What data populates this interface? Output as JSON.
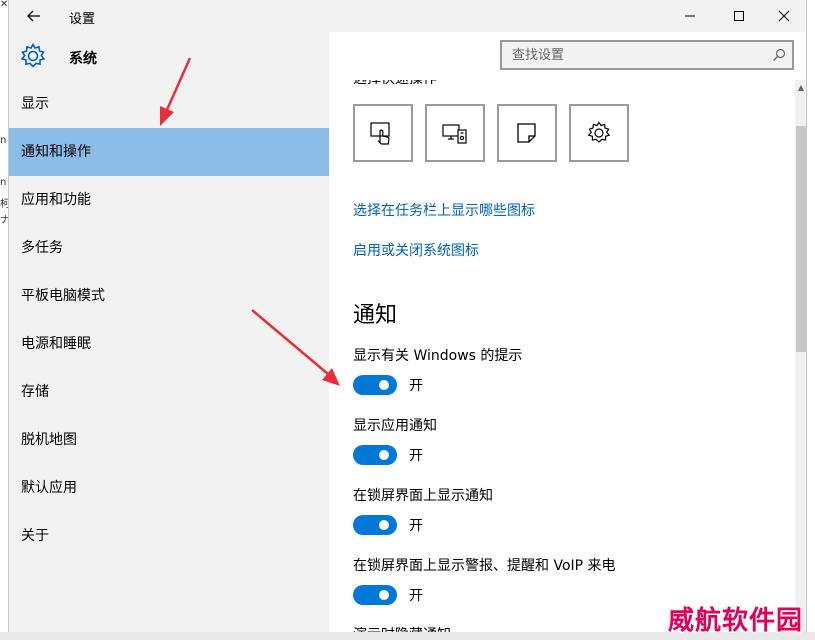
{
  "window": {
    "title": "设置"
  },
  "header": {
    "section_title": "系统"
  },
  "search": {
    "placeholder": "查找设置"
  },
  "sidebar": {
    "items": [
      {
        "label": "显示"
      },
      {
        "label": "通知和操作"
      },
      {
        "label": "应用和功能"
      },
      {
        "label": "多任务"
      },
      {
        "label": "平板电脑模式"
      },
      {
        "label": "电源和睡眠"
      },
      {
        "label": "存储"
      },
      {
        "label": "脱机地图"
      },
      {
        "label": "默认应用"
      },
      {
        "label": "关于"
      }
    ],
    "selected_index": 1
  },
  "main": {
    "partial_heading": "选择快速操作",
    "quick_action_icons": [
      "tablet-mode-icon",
      "connect-display-icon",
      "note-icon",
      "settings-gear-icon"
    ],
    "links": {
      "taskbar_icons": "选择在任务栏上显示哪些图标",
      "system_icons": "启用或关闭系统图标"
    },
    "notifications": {
      "heading": "通知",
      "settings": [
        {
          "label": "显示有关 Windows 的提示",
          "state": "开"
        },
        {
          "label": "显示应用通知",
          "state": "开"
        },
        {
          "label": "在锁屏界面上显示通知",
          "state": "开"
        },
        {
          "label": "在锁屏界面上显示警报、提醒和 VoIP 来电",
          "state": "开"
        }
      ],
      "cut_off_label": "演示时隐藏通知"
    }
  },
  "colors": {
    "selected_nav": "#8bbde8",
    "toggle_on": "#0078d7",
    "link": "#0063b1",
    "annotation_arrow": "#e8303a",
    "watermark": "#e0005a"
  },
  "watermark": {
    "text": "威航软件园"
  }
}
